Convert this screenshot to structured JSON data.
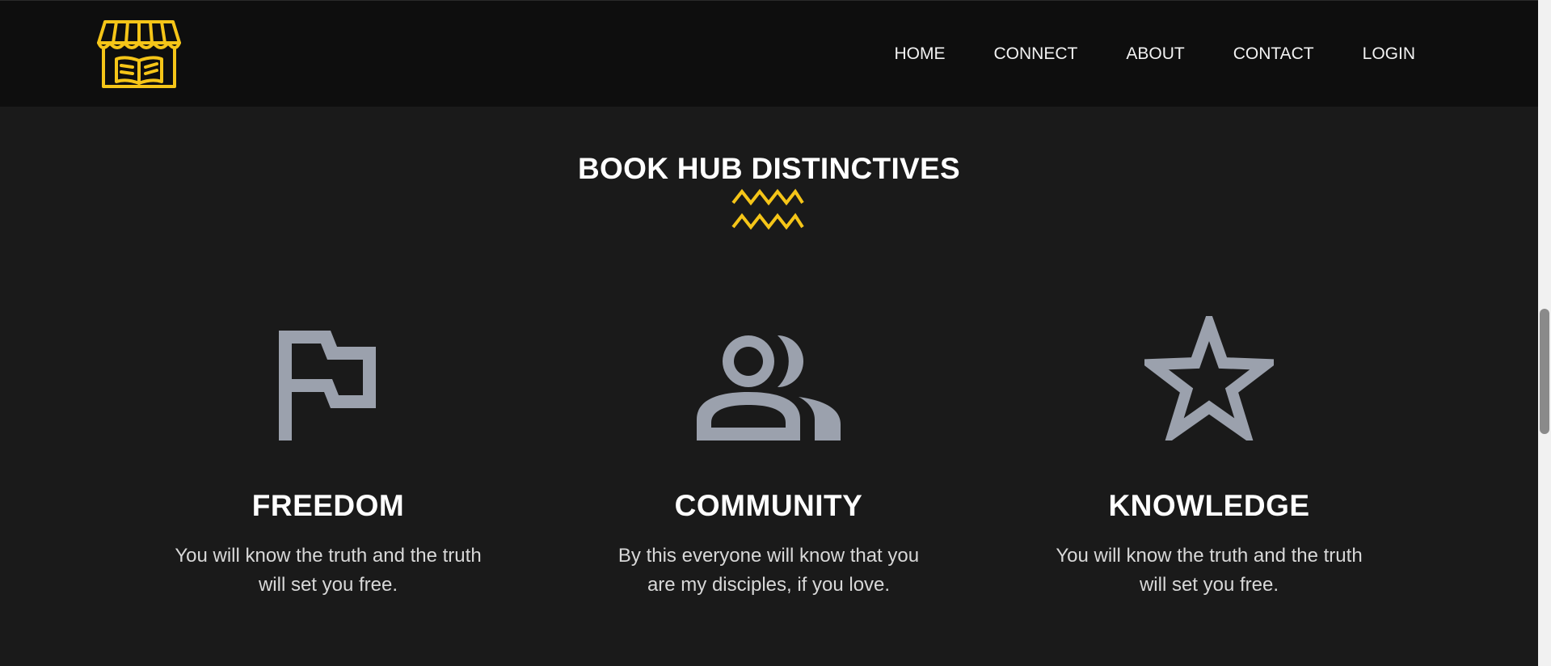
{
  "nav": {
    "logo_icon": "bookstore-storefront-icon",
    "links": [
      "HOME",
      "CONNECT",
      "ABOUT",
      "CONTACT",
      "LOGIN"
    ]
  },
  "section": {
    "title": "BOOK HUB DISTINCTIVES",
    "divider_icon": "zigzag-icon"
  },
  "features": [
    {
      "icon": "flag-icon",
      "title": "FREEDOM",
      "text": "You will know the truth and the truth will set you free."
    },
    {
      "icon": "people-icon",
      "title": "COMMUNITY",
      "text": "By this everyone will know that you are my disciples, if you love."
    },
    {
      "icon": "star-icon",
      "title": "KNOWLEDGE",
      "text": "You will know the truth and the truth will set you free."
    }
  ],
  "colors": {
    "accent": "#f5c518",
    "icon_gray": "#9ba1ad",
    "background": "#1a1a1a",
    "navbar": "#0e0e0e"
  }
}
